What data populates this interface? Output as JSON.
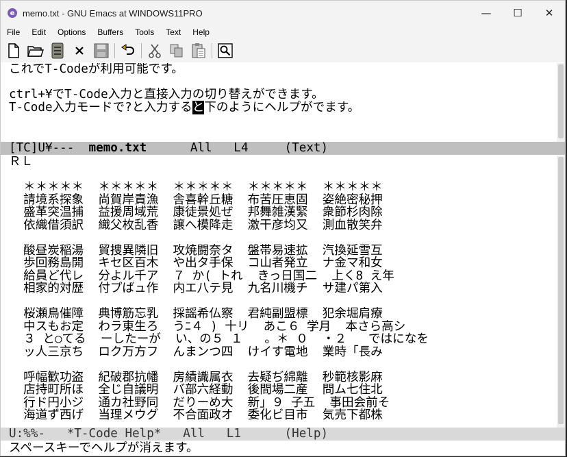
{
  "window": {
    "title": "memo.txt - GNU Emacs at WINDOWS11PRO",
    "controls": {
      "minimize": "—",
      "maximize": "☐",
      "close": "✕"
    }
  },
  "menu": [
    "File",
    "Edit",
    "Options",
    "Buffers",
    "Tools",
    "Text",
    "Help"
  ],
  "toolbar": [
    "new-file",
    "open-folder",
    "dired",
    "close-buffer",
    "save",
    "undo",
    "cut",
    "copy",
    "paste",
    "search"
  ],
  "top_pane": {
    "line1": "これでT-Codeが利用可能です。",
    "line2": "",
    "line3": "ctrl+¥でT-Code入力と直接入力の切り替えができます。",
    "line4_before": "T-Code入力モードで?と入力する",
    "line4_highlight": "と",
    "line4_after": "下のようにヘルプがでます。"
  },
  "modeline1": {
    "prefix": "[TC]U¥---  ",
    "buffer": "memo.txt",
    "suffix": "      All   L4     (Text)"
  },
  "bottom_pane": {
    "line1": "ＲＬ",
    "lines": [
      "",
      "  ＊＊＊＊＊  ＊＊＊＊＊  ＊＊＊＊＊  ＊＊＊＊＊  ＊＊＊＊＊",
      "  請境系探象  尚賀岸責漁  舎喜幹丘糖  布苦圧恵固  姿絶密秘押",
      "  盛革突温捕  益援周域荒  康徒景処ぜ  邦舞雑漢緊  衆節杉肉除",
      "  依織借須訳  織父枚乱香  譲へ模降走  激干彦均又  測血散笑弁",
      "",
      "  酸昼炭稲湯  貿捜異隣旧  攻焼闘奈タ  盤帯易速拡  汽換延雪互",
      "  歩回務島開  キセ区百木  や出タ手保  コ山者発立  ナ金マ和女",
      "  給員ど代レ  分よル千ア  ７ か( トれ  きっ日国二  上く8 え年",
      "  相家的対歴  付プばュ作  内エ八テ見  九名川機チ  サ建パ第入",
      "",
      "  桜瀬鳥催障  典博筋忘乳  採謡希仏察  君純副盟標  犯余堀肩療",
      "  中スもお定  わラ東生ろ  うﾆ４ ) 十リ  あこ６ 学月  本さら高シ",
      "  ３ と○てる  ーしたーが  い、の５ １   。＊ ０  ・２   ではになを",
      "  ッ人三京ち  ロク万方フ  んまンつ四  けイす電地  業時「長み",
      "",
      "  呼幅歓功盗  紀破郡抗幡  房績識属衣  去疑ぢ綿離  秒範核影麻",
      "  店持町所ほ  全じ自議明  バ部六経動  後間場二産  問ム七住北",
      "  行ド円小ジ  通カ社野同  だりーめ大  新」９ 子五  事田会前そ",
      "  海道ず西げ  当理メウグ  不合面政オ  委化ビ目市  気売下都株"
    ]
  },
  "modeline2": {
    "prefix": "U:%%-   ",
    "buffer": "*T-Code Help*",
    "suffix": "   All   L1      (Help)"
  },
  "echo_area": "スペースキーでヘルプが消えます。"
}
